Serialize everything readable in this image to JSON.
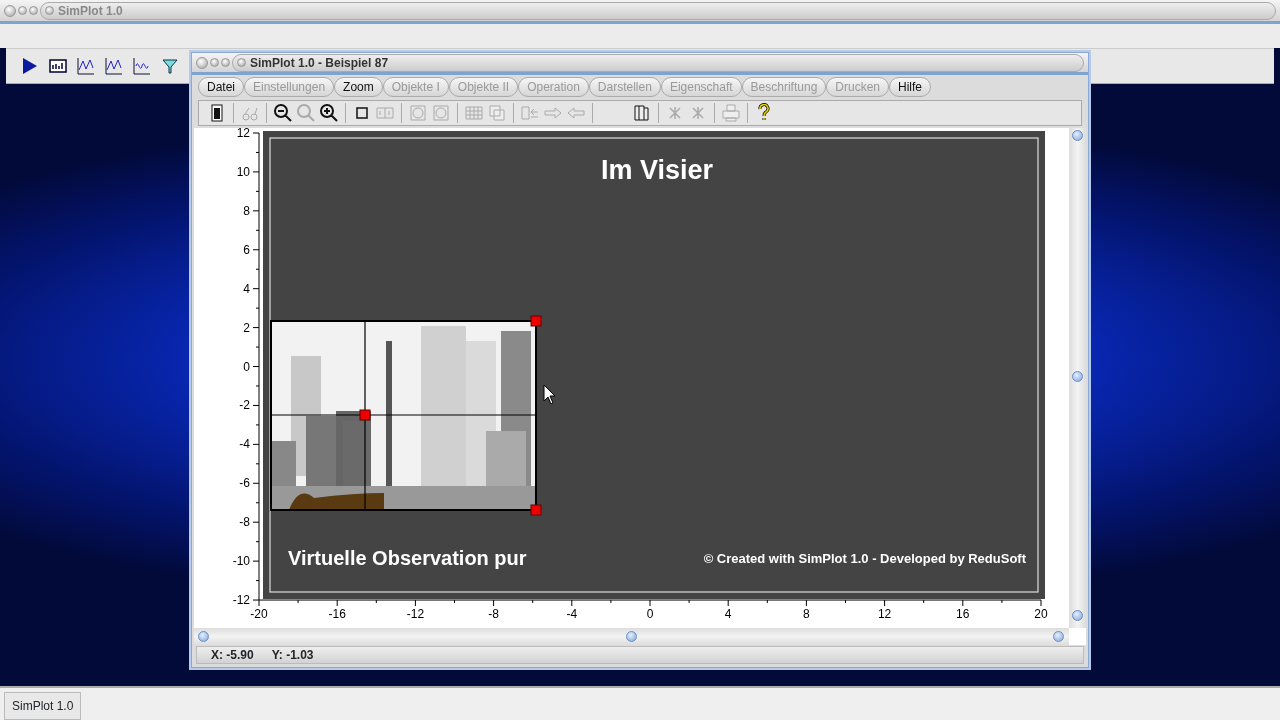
{
  "app": {
    "title": "SimPlot 1.0",
    "taskbar_item": "SimPlot 1.0"
  },
  "window": {
    "title": "SimPlot 1.0 - Beispiel 87"
  },
  "menu": [
    {
      "label": "Datei",
      "disabled": false
    },
    {
      "label": "Einstellungen",
      "disabled": true
    },
    {
      "label": "Zoom",
      "disabled": false
    },
    {
      "label": "Objekte I",
      "disabled": true
    },
    {
      "label": "Objekte II",
      "disabled": true
    },
    {
      "label": "Operation",
      "disabled": true
    },
    {
      "label": "Darstellen",
      "disabled": true
    },
    {
      "label": "Eigenschaft",
      "disabled": true
    },
    {
      "label": "Beschriftung",
      "disabled": true
    },
    {
      "label": "Drucken",
      "disabled": true
    },
    {
      "label": "Hilfe",
      "disabled": false
    }
  ],
  "toolbar": [
    {
      "kind": "device",
      "disabled": false
    },
    {
      "kind": "glasses",
      "disabled": true
    },
    {
      "kind": "zoomout",
      "disabled": false
    },
    {
      "kind": "zoom",
      "disabled": true
    },
    {
      "kind": "zoomin",
      "disabled": false
    },
    {
      "kind": "square",
      "disabled": false
    },
    {
      "kind": "pair",
      "disabled": true
    },
    {
      "kind": "circle",
      "disabled": true
    },
    {
      "kind": "circle",
      "disabled": true
    },
    {
      "kind": "grid",
      "disabled": true
    },
    {
      "kind": "pages",
      "disabled": true
    },
    {
      "kind": "boxarrow",
      "disabled": true
    },
    {
      "kind": "right",
      "disabled": true
    },
    {
      "kind": "left",
      "disabled": true
    },
    {
      "kind": "copy",
      "disabled": false
    },
    {
      "kind": "cross",
      "disabled": true
    },
    {
      "kind": "cross",
      "disabled": true
    },
    {
      "kind": "printer",
      "disabled": true
    },
    {
      "kind": "help",
      "disabled": false
    }
  ],
  "plot": {
    "title": "Im Visier",
    "subtitle": "Virtuelle Observation pur",
    "credit": "© Created with SimPlot 1.0 - Developed by ReduSoft",
    "y_ticks": [
      "12",
      "10",
      "8",
      "6",
      "4",
      "2",
      "0",
      "-2",
      "-4",
      "-6",
      "-8",
      "-10",
      "-12"
    ],
    "x_ticks": [
      "-20",
      "-16",
      "-12",
      "-8",
      "-4",
      "0",
      "4",
      "8",
      "12",
      "16",
      "20"
    ]
  },
  "status_bar": {
    "x": "X: -5.90",
    "y": "Y: -1.03"
  }
}
